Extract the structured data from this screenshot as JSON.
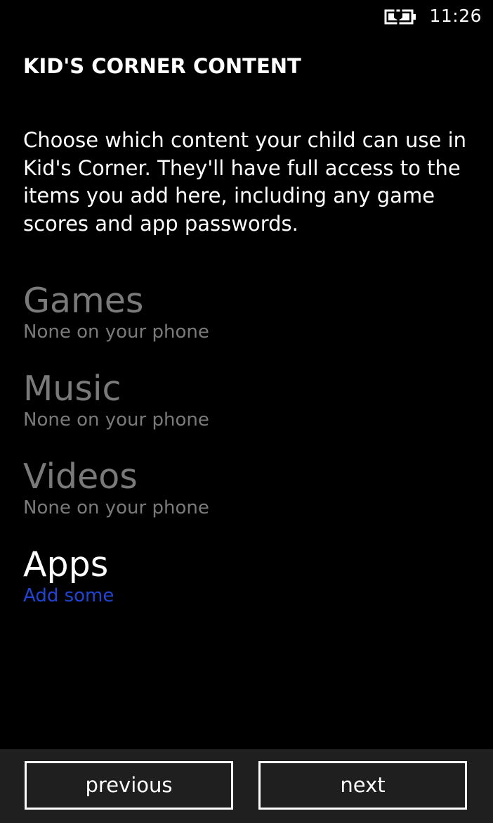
{
  "status_bar": {
    "time": "11:26",
    "battery_icon": "battery-charging-icon"
  },
  "page": {
    "title": "KID'S CORNER CONTENT",
    "description": "Choose which content your child can use in Kid's Corner. They'll have full access to the items you add here, including any game scores and app passwords."
  },
  "categories": [
    {
      "title": "Games",
      "subtitle": "None on your phone",
      "enabled": false
    },
    {
      "title": "Music",
      "subtitle": "None on your phone",
      "enabled": false
    },
    {
      "title": "Videos",
      "subtitle": "None on your phone",
      "enabled": false
    },
    {
      "title": "Apps",
      "subtitle": "Add some",
      "enabled": true
    }
  ],
  "app_bar": {
    "previous_label": "previous",
    "next_label": "next"
  },
  "colors": {
    "background": "#000000",
    "disabled_text": "#7a7a7a",
    "accent": "#1f45d6",
    "app_bar": "#1f1f1f"
  }
}
